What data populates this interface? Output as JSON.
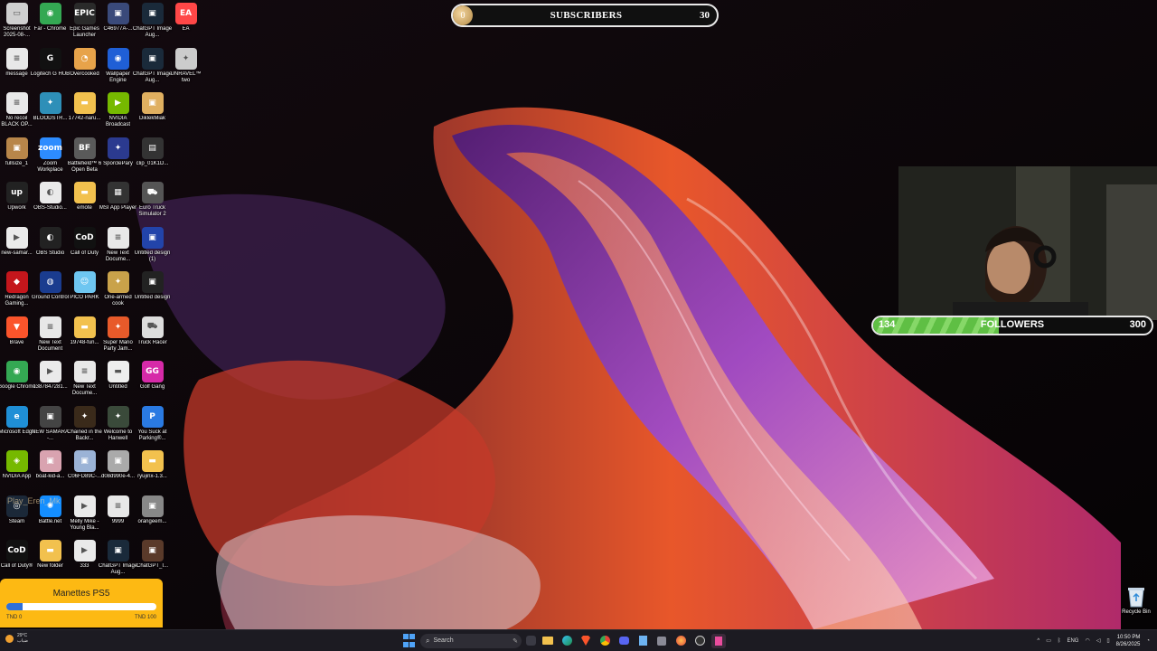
{
  "desktop": {
    "columns": [
      [
        {
          "label": "Screenshot 2025-08-...",
          "icon": "screenshot-file-icon",
          "color": "#cfcfcf",
          "glyph": "▭"
        },
        {
          "label": "message",
          "icon": "text-file-icon",
          "color": "#e8e8e8",
          "glyph": "≡"
        },
        {
          "label": "No recoil BLACK OP...",
          "icon": "text-file-icon",
          "color": "#e8e8e8",
          "glyph": "≡"
        },
        {
          "label": "fullsize_1",
          "icon": "image-file-icon",
          "color": "#b8864a",
          "glyph": "▣"
        },
        {
          "label": "Upwork",
          "icon": "upwork-icon",
          "color": "#222222",
          "glyph": "up"
        },
        {
          "label": "new-samar...",
          "icon": "video-file-icon",
          "color": "#eaeaea",
          "glyph": "▶"
        },
        {
          "label": "Redragon Gaming...",
          "icon": "redragon-icon",
          "color": "#c4161c",
          "glyph": "◆"
        },
        {
          "label": "Brave",
          "icon": "brave-icon",
          "color": "#fb542b",
          "glyph": "▼"
        },
        {
          "label": "Google Chrome",
          "icon": "chrome-icon",
          "color": "#34a853",
          "glyph": "◉"
        },
        {
          "label": "Microsoft Edge",
          "icon": "edge-icon",
          "color": "#1f8fd6",
          "glyph": "e"
        },
        {
          "label": "NVIDIA App",
          "icon": "nvidia-icon",
          "color": "#76b900",
          "glyph": "◈"
        },
        {
          "label": "Steam",
          "icon": "steam-icon",
          "color": "#1b2838",
          "glyph": "◎"
        },
        {
          "label": "Call of Duty®",
          "icon": "call-of-duty-icon",
          "color": "#111111",
          "glyph": "CoD"
        }
      ],
      [
        {
          "label": "Far - Chrome",
          "icon": "chrome-icon",
          "color": "#34a853",
          "glyph": "◉"
        },
        {
          "label": "Logitech G HUB",
          "icon": "logitech-icon",
          "color": "#111111",
          "glyph": "G"
        },
        {
          "label": "BLOODSTR...",
          "icon": "game-icon",
          "color": "#2e8fb8",
          "glyph": "✦"
        },
        {
          "label": "Zoom Workplace",
          "icon": "zoom-icon",
          "color": "#2d8cff",
          "glyph": "zoom"
        },
        {
          "label": "OBS-Studio...",
          "icon": "obs-icon",
          "color": "#eaeaea",
          "glyph": "◐"
        },
        {
          "label": "OBS Studio",
          "icon": "obs-icon",
          "color": "#222222",
          "glyph": "◐"
        },
        {
          "label": "Ground Control",
          "icon": "ground-control-icon",
          "color": "#1a3c8f",
          "glyph": "◍"
        },
        {
          "label": "New Text Document",
          "icon": "text-file-icon",
          "color": "#e8e8e8",
          "glyph": "≡"
        },
        {
          "label": "1387847281...",
          "icon": "video-file-icon",
          "color": "#eaeaea",
          "glyph": "▶"
        },
        {
          "label": "NEW SAMARA -...",
          "icon": "image-file-icon",
          "color": "#444444",
          "glyph": "▣"
        },
        {
          "label": "boat-kid-a...",
          "icon": "image-file-icon",
          "color": "#d9a3b0",
          "glyph": "▣"
        },
        {
          "label": "Battle.net",
          "icon": "battlenet-icon",
          "color": "#148eff",
          "glyph": "✺"
        },
        {
          "label": "New folder",
          "icon": "folder-icon",
          "color": "#f2c14e",
          "glyph": "▬"
        }
      ],
      [
        {
          "label": "Epic Games Launcher",
          "icon": "epic-games-icon",
          "color": "#2a2a2a",
          "glyph": "EPIC"
        },
        {
          "label": "Overcooked",
          "icon": "overcooked-icon",
          "color": "#e7a34a",
          "glyph": "◔"
        },
        {
          "label": "17742-naru...",
          "icon": "folder-icon",
          "color": "#f2c14e",
          "glyph": "▬"
        },
        {
          "label": "Battlefield™ 6 Open Beta",
          "icon": "battlefield-icon",
          "color": "#5a5a5a",
          "glyph": "BF"
        },
        {
          "label": "emote",
          "icon": "folder-icon",
          "color": "#f2c14e",
          "glyph": "▬"
        },
        {
          "label": "Call of Duty",
          "icon": "call-of-duty-icon",
          "color": "#111111",
          "glyph": "CoD"
        },
        {
          "label": "PICO PARK",
          "icon": "pico-park-icon",
          "color": "#6ec6f1",
          "glyph": "☺"
        },
        {
          "label": "19748-fun...",
          "icon": "folder-icon",
          "color": "#f2c14e",
          "glyph": "▬"
        },
        {
          "label": "New Text Docume...",
          "icon": "text-file-icon",
          "color": "#e8e8e8",
          "glyph": "≡"
        },
        {
          "label": "Chained in the Backr...",
          "icon": "game-icon",
          "color": "#3a2a1a",
          "glyph": "✦"
        },
        {
          "label": "C06FD89C-...",
          "icon": "image-file-icon",
          "color": "#9bb3d6",
          "glyph": "▣"
        },
        {
          "label": "Melly Mike - Young Bla...",
          "icon": "video-file-icon",
          "color": "#eaeaea",
          "glyph": "▶"
        },
        {
          "label": "333",
          "icon": "video-file-icon",
          "color": "#eaeaea",
          "glyph": "▶"
        }
      ],
      [
        {
          "label": "C46977A-...",
          "icon": "image-file-icon",
          "color": "#3a4a7a",
          "glyph": "▣"
        },
        {
          "label": "Wallpaper Engine",
          "icon": "wallpaper-engine-icon",
          "color": "#1f5fd6",
          "glyph": "◉"
        },
        {
          "label": "NVIDIA Broadcast",
          "icon": "nvidia-icon",
          "color": "#76b900",
          "glyph": "▶"
        },
        {
          "label": "SporclePary",
          "icon": "game-icon",
          "color": "#2b3a8f",
          "glyph": "✦"
        },
        {
          "label": "MSI App Player",
          "icon": "msi-icon",
          "color": "#333333",
          "glyph": "▦"
        },
        {
          "label": "New Text Docume...",
          "icon": "text-file-icon",
          "color": "#e8e8e8",
          "glyph": "≡"
        },
        {
          "label": "One-armed cook",
          "icon": "game-icon",
          "color": "#c9a24a",
          "glyph": "✦"
        },
        {
          "label": "Super Mario Party Jam...",
          "icon": "game-icon",
          "color": "#e85a2a",
          "glyph": "✦"
        },
        {
          "label": "Untitled",
          "icon": "image-file-icon",
          "color": "#eeeeee",
          "glyph": "▬"
        },
        {
          "label": "Welcome to Hanwell",
          "icon": "game-icon",
          "color": "#3a4a3a",
          "glyph": "✦"
        },
        {
          "label": "d08d990e-4...",
          "icon": "image-file-icon",
          "color": "#aaaaaa",
          "glyph": "▣"
        },
        {
          "label": "9999",
          "icon": "text-file-icon",
          "color": "#e8e8e8",
          "glyph": "≡"
        },
        {
          "label": "ChatGPT Image Aug...",
          "icon": "image-file-icon",
          "color": "#1a2a3a",
          "glyph": "▣"
        }
      ],
      [
        {
          "label": "ChatGPT Image Aug...",
          "icon": "image-file-icon",
          "color": "#1a2a3a",
          "glyph": "▣"
        },
        {
          "label": "ChatGPT Image Aug...",
          "icon": "image-file-icon",
          "color": "#1a2a3a",
          "glyph": "▣"
        },
        {
          "label": "DiklekMiak",
          "icon": "image-file-icon",
          "color": "#e0b060",
          "glyph": "▣"
        },
        {
          "label": "clip_01K1D...",
          "icon": "video-file-icon",
          "color": "#333333",
          "glyph": "▤"
        },
        {
          "label": "Euro Truck Simulator 2",
          "icon": "euro-truck-icon",
          "color": "#555555",
          "glyph": "⛟"
        },
        {
          "label": "Untitled design (1)",
          "icon": "image-file-icon",
          "color": "#2244aa",
          "glyph": "▣"
        },
        {
          "label": "Untitled design",
          "icon": "image-file-icon",
          "color": "#222222",
          "glyph": "▣"
        },
        {
          "label": "Truck Racer",
          "icon": "truck-racer-icon",
          "color": "#dddddd",
          "glyph": "⛟"
        },
        {
          "label": "Golf Gang",
          "icon": "golf-gang-icon",
          "color": "#d62aa8",
          "glyph": "GG"
        },
        {
          "label": "You Suck at Parking®...",
          "icon": "parking-icon",
          "color": "#2a7ae2",
          "glyph": "P"
        },
        {
          "label": "ryujinx-1.3...",
          "icon": "folder-icon",
          "color": "#f2c14e",
          "glyph": "▬"
        },
        {
          "label": "orangeem...",
          "icon": "image-file-icon",
          "color": "#888888",
          "glyph": "▣"
        },
        {
          "label": "ChatGPT_I...",
          "icon": "image-file-icon",
          "color": "#5a3a2a",
          "glyph": "▣"
        }
      ],
      [
        {
          "label": "EA",
          "icon": "ea-icon",
          "color": "#ff4747",
          "glyph": "EA"
        },
        {
          "label": "UNRAVEL™ two",
          "icon": "game-icon",
          "color": "#cccccc",
          "glyph": "✦"
        }
      ]
    ]
  },
  "overlay_text": "Play_Eren_Mk",
  "subscribers_goal": {
    "current": "0",
    "label": "SUBSCRIBERS",
    "goal": "30"
  },
  "followers_goal": {
    "current": "134",
    "label": "FOLLOWERS",
    "goal": "300",
    "progress_fraction": 0.45
  },
  "donation_goal": {
    "title": "Manettes PS5",
    "min_label": "TND 0",
    "max_label": "TND 100",
    "progress_fraction": 0.11
  },
  "recycle_bin": {
    "label": "Recycle Bin"
  },
  "taskbar": {
    "weather_temp": "29°C",
    "weather_desc": "ضباب",
    "search_label": "Search",
    "language": "ENG",
    "time": "10:50 PM",
    "date": "8/26/2025"
  }
}
